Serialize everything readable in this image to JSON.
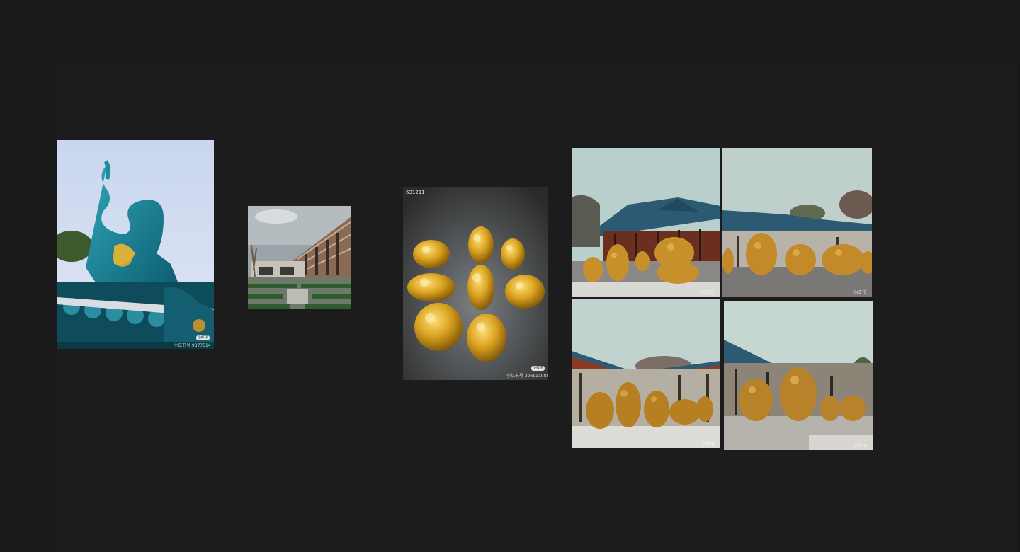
{
  "canvas": {
    "background_color": "#1c1c1c"
  },
  "images": [
    {
      "id_label": "",
      "subject": "teal-dragon-roof-ornament",
      "badge": "小红书",
      "watermark": "小红书号 9377514"
    },
    {
      "id_label": "",
      "subject": "modern-building-garden",
      "badge": "",
      "watermark": ""
    },
    {
      "id_label": "631211",
      "subject": "golden-animal-figurines",
      "badge": "小红书",
      "watermark": "小红书号 296911988"
    },
    {
      "id_label": "",
      "subject": "golden-zodiac-statues-1",
      "badge": "",
      "watermark": "小红书"
    },
    {
      "id_label": "",
      "subject": "golden-zodiac-statues-2",
      "badge": "",
      "watermark": "小红书"
    },
    {
      "id_label": "",
      "subject": "golden-zodiac-statues-3",
      "badge": "",
      "watermark": "小红书"
    },
    {
      "id_label": "",
      "subject": "golden-zodiac-statues-4",
      "badge": "",
      "watermark": "小红书"
    }
  ]
}
